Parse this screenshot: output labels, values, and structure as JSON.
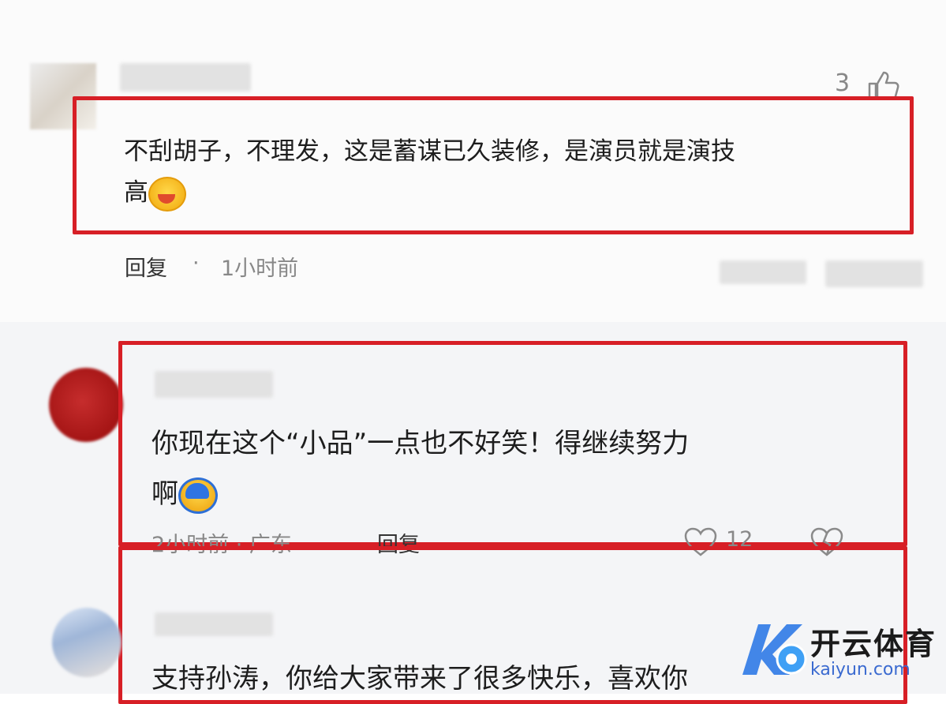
{
  "comments": [
    {
      "likes": "3",
      "text_line1": "不刮胡子，不理发，这是蓄谋已久装修，是演员就是演技",
      "text_line2": "高",
      "emoji": "laughing-crying-emoji",
      "reply_label": "回复",
      "dot": "·",
      "time": "1小时前"
    },
    {
      "text_line1": "你现在这个“小品”一点也不好笑！得继续努力",
      "text_line2": "啊",
      "emoji": "face-cover-emoji",
      "time_location": "2小时前 · 广东",
      "reply_label": "回复",
      "likes": "12"
    },
    {
      "text_line1": "支持孙涛，你给大家带来了很多快乐，喜欢你"
    }
  ],
  "watermark": {
    "title": "开云体育",
    "subtitle": "kaiyun.com"
  },
  "colors": {
    "highlight": "#d71f26",
    "watermark_blue": "#3a6ad0"
  }
}
